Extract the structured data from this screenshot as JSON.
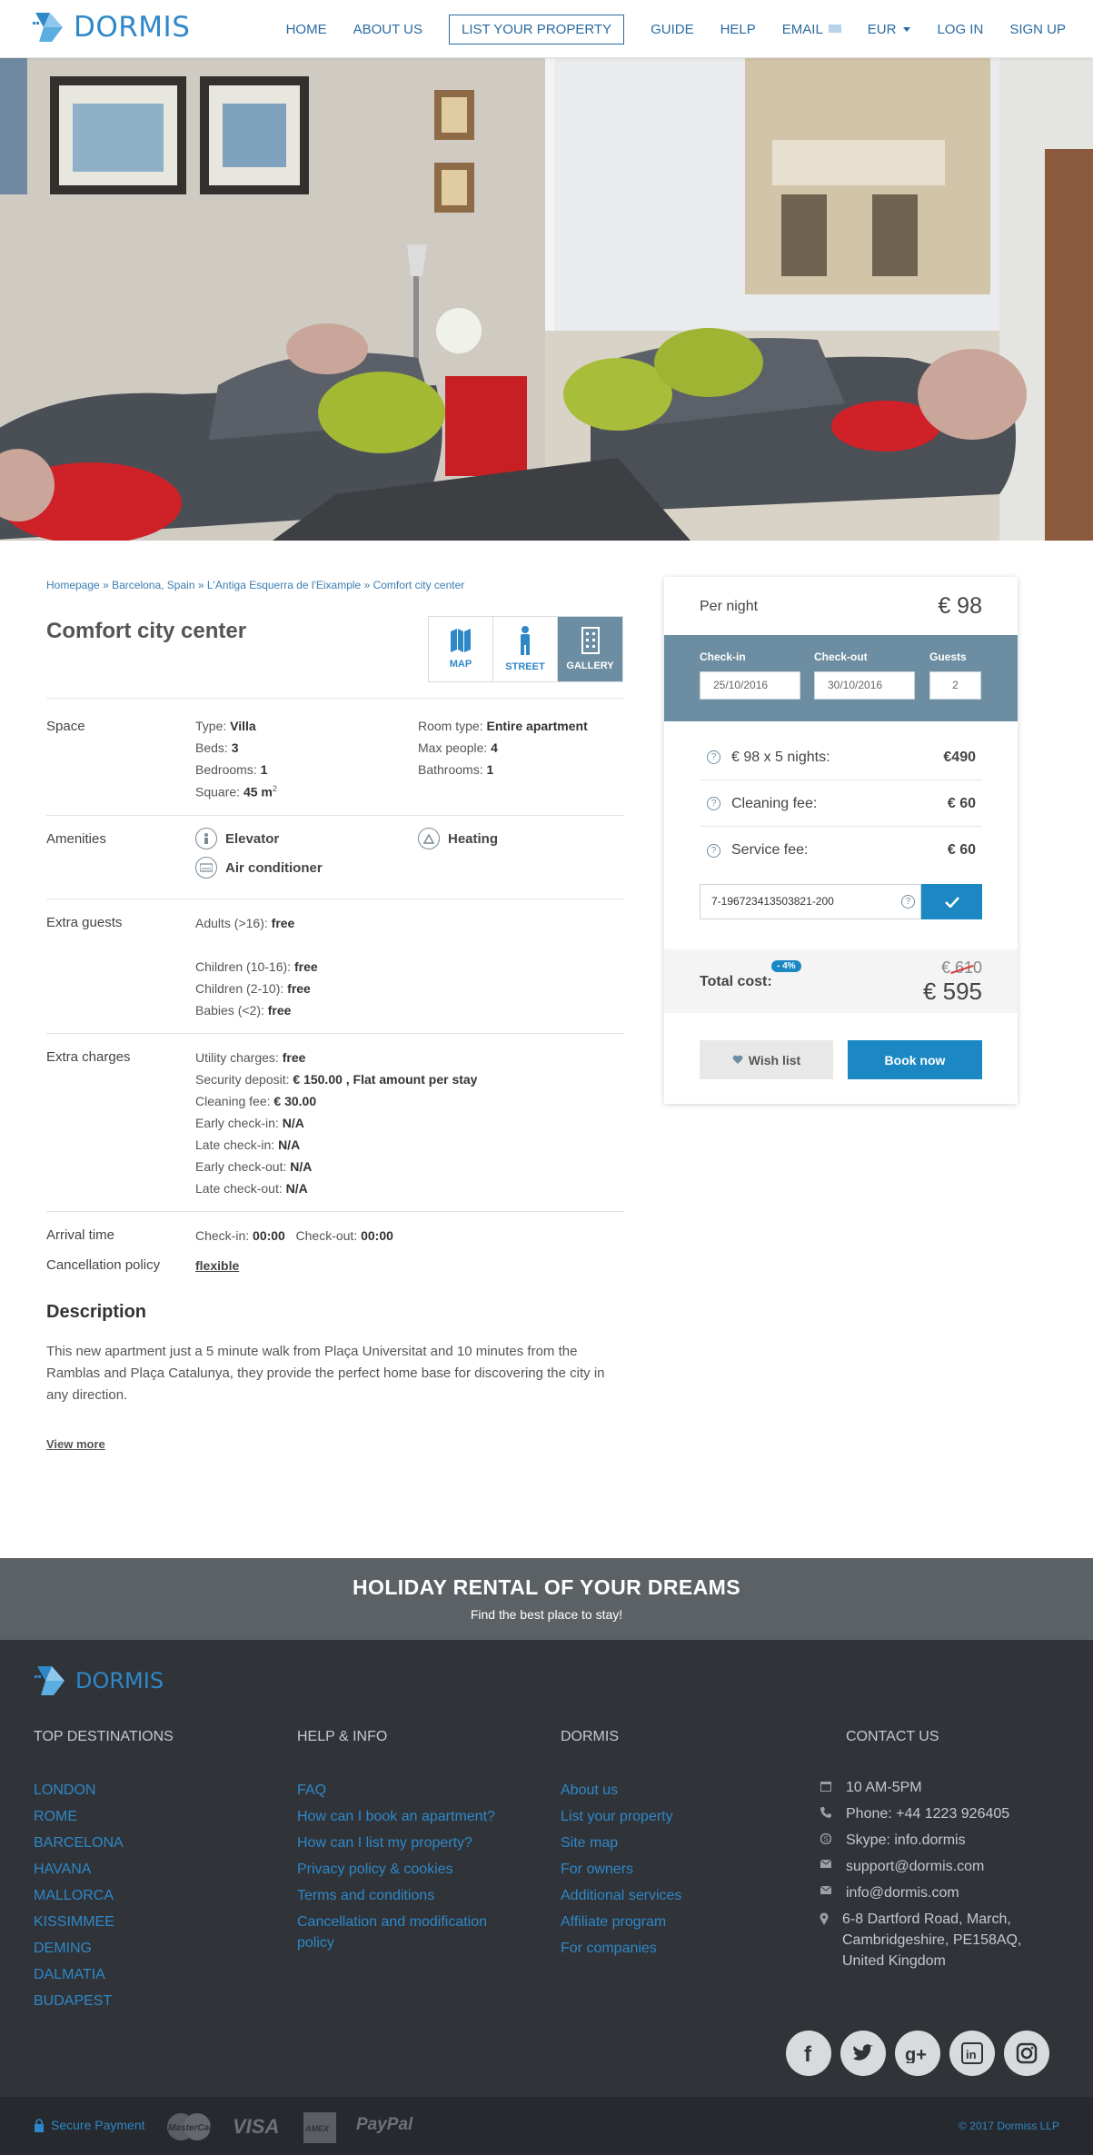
{
  "brand": {
    "name": "DORMIS",
    "accent": "#2e88c8",
    "card_header": "#6d8ea2"
  },
  "nav": {
    "home": "HOME",
    "about": "ABOUT US",
    "list_property": "LIST YOUR PROPERTY",
    "guide": "GUIDE",
    "help": "HELP",
    "email": "EMAIL",
    "currency": "EUR",
    "login": "LOG IN",
    "signup": "SIGN UP"
  },
  "breadcrumb": {
    "items": [
      "Homepage",
      "Barcelona, Spain",
      "L'Antiga Esquerra de l'Eixample",
      "Comfort city center"
    ],
    "separator": "»"
  },
  "listing": {
    "title": "Comfort city center",
    "view_tabs": [
      {
        "label": "MAP",
        "icon": "map-icon"
      },
      {
        "label": "STREET",
        "icon": "person-icon"
      },
      {
        "label": "GALLERY",
        "icon": "gallery-icon",
        "active": true
      }
    ]
  },
  "space": {
    "label": "Space",
    "type_k": "Type:",
    "type_v": "Villa",
    "beds_k": "Beds:",
    "beds_v": "3",
    "bedrooms_k": "Bedrooms:",
    "bedrooms_v": "1",
    "square_k": "Square:",
    "square_v": "45 m",
    "square_sup": "2",
    "room_type_k": "Room type:",
    "room_type_v": "Entire apartment",
    "max_people_k": "Max people:",
    "max_people_v": "4",
    "bathrooms_k": "Bathrooms:",
    "bathrooms_v": "1"
  },
  "amenities": {
    "label": "Amenities",
    "items": [
      "Elevator",
      "Heating",
      "Air conditioner"
    ]
  },
  "extra_guests": {
    "label": "Extra guests",
    "adults_k": "Adults (>16):",
    "adults_v": "free",
    "children1_k": "Children (10-16):",
    "children1_v": "free",
    "children2_k": "Children (2-10):",
    "children2_v": "free",
    "babies_k": "Babies (<2):",
    "babies_v": "free"
  },
  "extra_charges": {
    "label": "Extra charges",
    "utility_k": "Utility charges:",
    "utility_v": "free",
    "deposit_k": "Security deposit:",
    "deposit_v": "€ 150.00 , Flat amount per stay",
    "cleaning_k": "Cleaning fee:",
    "cleaning_v": "€ 30.00",
    "early_in_k": "Early check-in:",
    "early_in_v": "N/A",
    "late_in_k": "Late check-in:",
    "late_in_v": "N/A",
    "early_out_k": "Early check-out:",
    "early_out_v": "N/A",
    "late_out_k": "Late check-out:",
    "late_out_v": "N/A"
  },
  "arrival": {
    "label": "Arrival time",
    "checkin_k": "Check-in:",
    "checkin_v": "00:00",
    "checkout_k": "Check-out:",
    "checkout_v": "00:00"
  },
  "cancellation": {
    "label": "Cancellation policy",
    "value": "flexible"
  },
  "description": {
    "heading": "Description",
    "text": "This new apartment just a 5 minute walk from Plaça Universitat and 10 minutes from the Ramblas and Plaça Catalunya, they provide the perfect home base for discovering the city in any direction.",
    "view_more": "View more"
  },
  "booking": {
    "per_night_label": "Per night",
    "per_night_price": "€ 98",
    "checkin_label": "Check-in",
    "checkin_value": "25/10/2016",
    "checkout_label": "Check-out",
    "checkout_value": "30/10/2016",
    "guests_label": "Guests",
    "guests_value": "2",
    "fees": [
      {
        "label": "€ 98 x 5 nights:",
        "value": "€490"
      },
      {
        "label": "Cleaning fee:",
        "value": "€ 60"
      },
      {
        "label": "Service fee:",
        "value": "€ 60"
      }
    ],
    "coupon_value": "7-196723413503821-200",
    "total_label": "Total cost:",
    "discount": "- 4%",
    "old_total": "€ 610",
    "new_total": "€ 595",
    "wishlist": "Wish list",
    "book": "Book now"
  },
  "promo": {
    "heading": "HOLIDAY RENTAL OF YOUR DREAMS",
    "sub": "Find the best place to stay!"
  },
  "footer": {
    "destinations_h": "TOP DESTINATIONS",
    "destinations": [
      "LONDON",
      "ROME",
      "BARCELONA",
      "HAVANA",
      "MALLORCA",
      "KISSIMMEE",
      "DEMING",
      "DALMATIA",
      "BUDAPEST"
    ],
    "help_h": "HELP & INFO",
    "help": [
      "FAQ",
      "How can I book an apartment?",
      "How can I list my property?",
      "Privacy policy & cookies",
      "Terms and conditions",
      "Cancellation and modification policy"
    ],
    "dormis_h": "DORMIS",
    "dormis": [
      "About us",
      "List your property",
      "Site map",
      "For owners",
      "Additional services",
      "Affiliate program",
      "For companies"
    ],
    "contact_h": "CONTACT US",
    "hours": "10 AM-5PM",
    "phone": "Phone: +44 1223 926405",
    "skype": "Skype: info.dormis",
    "email1": "support@dormis.com",
    "email2": "info@dormis.com",
    "address": "6-8 Dartford Road, March, Cambridgeshire, PE158AQ, United Kingdom",
    "social": [
      "facebook-icon",
      "twitter-icon",
      "google-plus-icon",
      "linkedin-icon",
      "instagram-icon"
    ],
    "secure": "Secure Payment",
    "payments": [
      "MasterCard",
      "VISA",
      "AMEX",
      "PayPal"
    ],
    "copyright": "© 2017 Dormiss LLP"
  }
}
